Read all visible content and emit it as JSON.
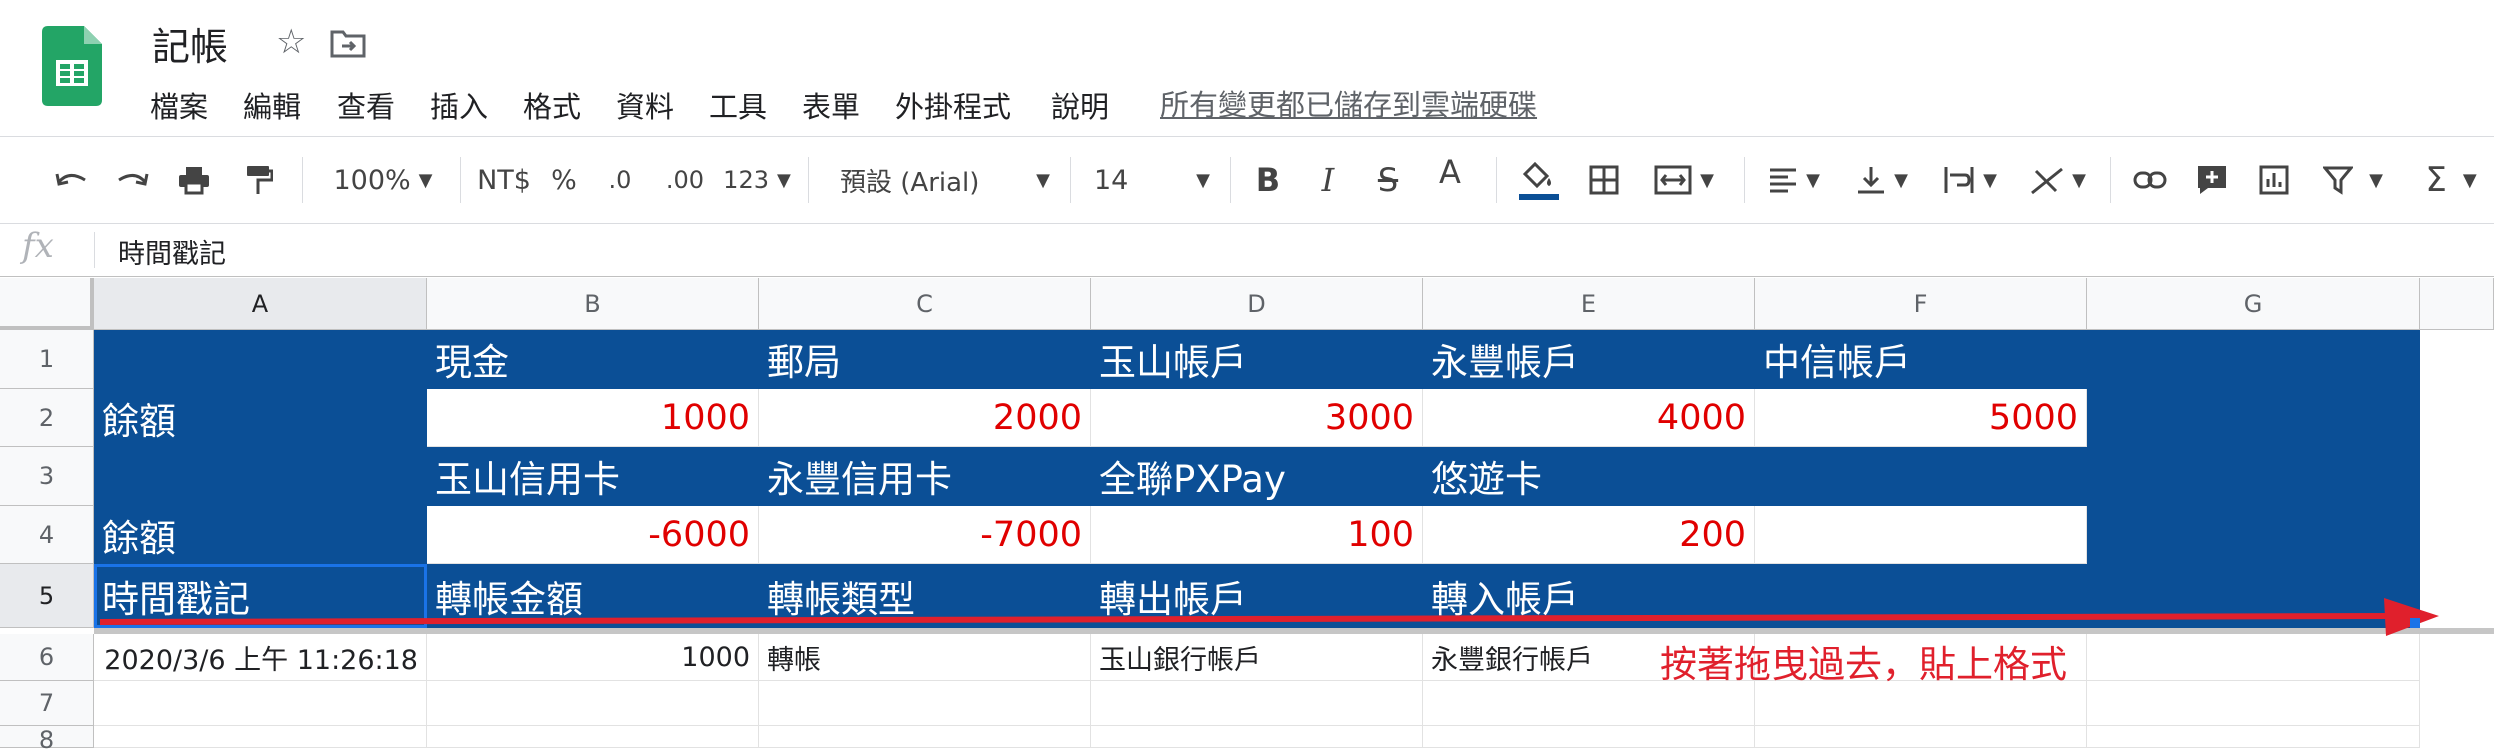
{
  "app": {
    "doc_title": "記帳",
    "save_status": "所有變更都已儲存到雲端硬碟",
    "menu": [
      "檔案",
      "編輯",
      "查看",
      "插入",
      "格式",
      "資料",
      "工具",
      "表單",
      "外掛程式",
      "說明"
    ]
  },
  "toolbar": {
    "zoom": "100%",
    "currency": "NT$",
    "percent": "%",
    "dec_decrease": ".0",
    "dec_increase": ".00",
    "number_format": "123",
    "font": "預設 (Arial)",
    "font_size": "14",
    "bold": "B",
    "italic": "I",
    "strike": "S",
    "text_color": "A",
    "sum": "Σ"
  },
  "formula_bar": {
    "fx": "fx",
    "value": "時間戳記"
  },
  "columns": [
    "A",
    "B",
    "C",
    "D",
    "E",
    "F",
    "G"
  ],
  "rows": [
    "1",
    "2",
    "3",
    "4",
    "5",
    "6",
    "7",
    "8"
  ],
  "cells": {
    "r1": [
      "",
      "現金",
      "郵局",
      "玉山帳戶",
      "永豐帳戶",
      "中信帳戶"
    ],
    "r2": [
      "餘額",
      "1000",
      "2000",
      "3000",
      "4000",
      "5000"
    ],
    "r3": [
      "",
      "玉山信用卡",
      "永豐信用卡",
      "全聯PXPay",
      "悠遊卡",
      ""
    ],
    "r4": [
      "餘額",
      "-6000",
      "-7000",
      "100",
      "200",
      ""
    ],
    "r5": [
      "時間戳記",
      "轉帳金額",
      "轉帳類型",
      "轉出帳戶",
      "轉入帳戶"
    ],
    "r6": [
      "2020/3/6 上午 11:26:18",
      "1000",
      "轉帳",
      "玉山銀行帳戶",
      "永豐銀行帳戶"
    ]
  },
  "annotation": "按著拖曳過去，貼上格式",
  "colors": {
    "header_fill": "#0b4f96",
    "negative_number": "#e00000",
    "annotation": "#e0202c",
    "arrow": "#e0202c"
  }
}
